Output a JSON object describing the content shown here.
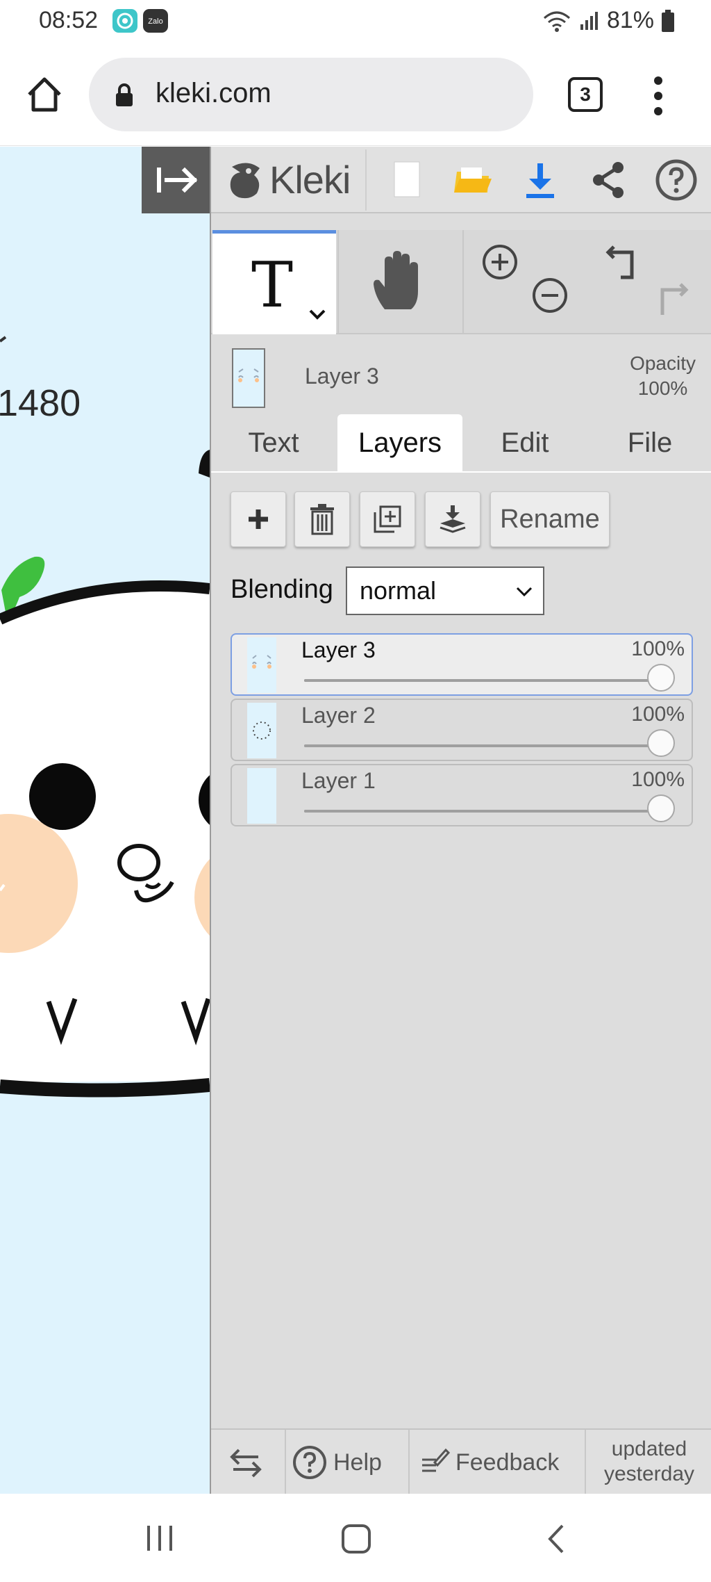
{
  "status_bar": {
    "time": "08:52",
    "app_icons": [
      "messenger-app-icon",
      "zalo-app-icon"
    ],
    "zalo_label": "Zalo",
    "battery": "81%"
  },
  "browser": {
    "url": "kleki.com",
    "tab_count": "3"
  },
  "canvas": {
    "visible_text": "1480"
  },
  "app": {
    "name": "Kleki",
    "accent": "#5b8fe0",
    "download_color": "#1a73e8",
    "folder_color": "#f5c52a"
  },
  "tools": {
    "active": "text",
    "items": [
      "text-tool",
      "hand-tool",
      "zoom-in",
      "zoom-out",
      "undo",
      "redo"
    ]
  },
  "current_layer": {
    "name": "Layer 3",
    "opacity_label": "Opacity",
    "opacity_value": "100%"
  },
  "tabs": [
    {
      "label": "Text"
    },
    {
      "label": "Layers"
    },
    {
      "label": "Edit"
    },
    {
      "label": "File"
    }
  ],
  "layer_actions": {
    "rename_label": "Rename"
  },
  "blending": {
    "label": "Blending",
    "value": "normal"
  },
  "layers": [
    {
      "name": "Layer 3",
      "opacity": "100%",
      "opacity_fraction": 1.0,
      "selected": true
    },
    {
      "name": "Layer 2",
      "opacity": "100%",
      "opacity_fraction": 1.0,
      "selected": false
    },
    {
      "name": "Layer 1",
      "opacity": "100%",
      "opacity_fraction": 1.0,
      "selected": false
    }
  ],
  "bottom": {
    "help_label": "Help",
    "feedback_label": "Feedback",
    "updated_line1": "updated",
    "updated_line2": "yesterday"
  }
}
